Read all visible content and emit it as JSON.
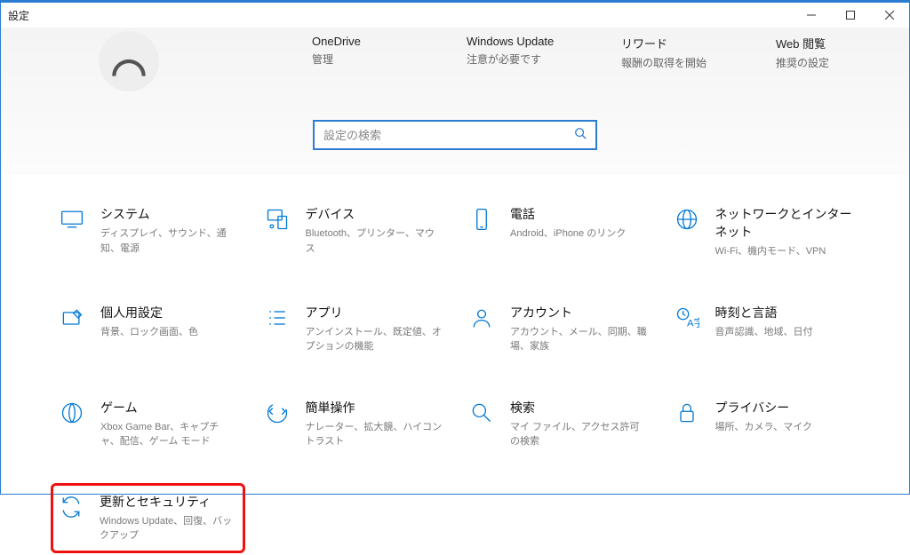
{
  "window": {
    "title": "設定"
  },
  "header": {
    "links": [
      {
        "title": "OneDrive",
        "sub": "管理"
      },
      {
        "title": "Windows Update",
        "sub": "注意が必要です"
      },
      {
        "title": "リワード",
        "sub": "報酬の取得を開始"
      },
      {
        "title": "Web 閲覧",
        "sub": "推奨の設定"
      }
    ]
  },
  "search": {
    "placeholder": "設定の検索"
  },
  "categories": [
    {
      "title": "システム",
      "sub": "ディスプレイ、サウンド、通知、電源"
    },
    {
      "title": "デバイス",
      "sub": "Bluetooth、プリンター、マウス"
    },
    {
      "title": "電話",
      "sub": "Android、iPhone のリンク"
    },
    {
      "title": "ネットワークとインターネット",
      "sub": "Wi-Fi、機内モード、VPN"
    },
    {
      "title": "個人用設定",
      "sub": "背景、ロック画面、色"
    },
    {
      "title": "アプリ",
      "sub": "アンインストール、既定値、オプションの機能"
    },
    {
      "title": "アカウント",
      "sub": "アカウント、メール、同期、職場、家族"
    },
    {
      "title": "時刻と言語",
      "sub": "音声認識、地域、日付"
    },
    {
      "title": "ゲーム",
      "sub": "Xbox Game Bar、キャプチャ、配信、ゲーム モード"
    },
    {
      "title": "簡単操作",
      "sub": "ナレーター、拡大鏡、ハイコントラスト"
    },
    {
      "title": "検索",
      "sub": "マイ ファイル、アクセス許可の検索"
    },
    {
      "title": "プライバシー",
      "sub": "場所、カメラ、マイク"
    },
    {
      "title": "更新とセキュリティ",
      "sub": "Windows Update、回復、バックアップ"
    }
  ]
}
